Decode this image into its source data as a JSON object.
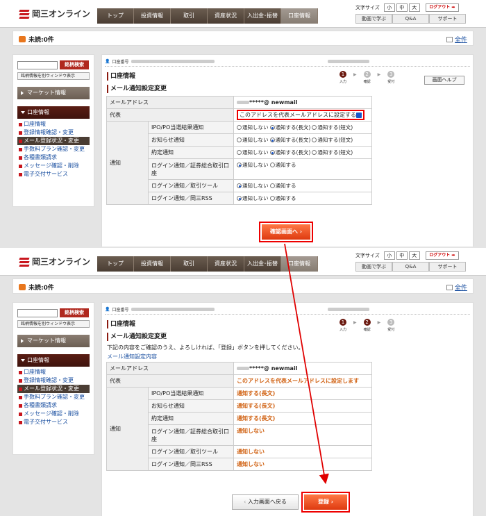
{
  "header": {
    "logo_text": "岡三オンライン",
    "nav": [
      "トップ",
      "投資情報",
      "取引",
      "資産状況",
      "入出金･振替",
      "口座情報"
    ],
    "font_size_label": "文字サイズ",
    "font_sizes": [
      "小",
      "中",
      "大"
    ],
    "logout": "ログアウト",
    "util_links": [
      "動画で学ぶ",
      "Q&A",
      "サポート"
    ]
  },
  "infobar": {
    "unread": "未読:0件",
    "all": "全件"
  },
  "sidebar": {
    "search_button": "銘柄検索",
    "new_window": "銘柄情報を別ウィンドウ表示",
    "market_info": "マーケット情報",
    "account_info": "口座情報",
    "menu": [
      "口座情報",
      "登録情報確認・変更",
      "メール登録状況・変更",
      "手数料プラン確認・変更",
      "各種書類請求",
      "メッセージ確認・削除",
      "電子交付サービス"
    ]
  },
  "main": {
    "account_label": "口座番号",
    "page_title": "口座情報",
    "page_subtitle": "メール通知設定変更",
    "steps": [
      "入力",
      "確認",
      "受付"
    ],
    "help_button": "画面ヘルプ",
    "email_label": "メールアドレス",
    "email_value": "*****@ newmail",
    "primary_label": "代表",
    "primary_checkbox": "このアドレスを代表メールアドレスに設定する",
    "notify_label": "通知",
    "rows": [
      "IPO/PO当選結果通知",
      "お知らせ通知",
      "約定通知",
      "ログイン通知／証券総合取引口座",
      "ログイン通知／取引ツール",
      "ログイン通知／岡三RSS"
    ],
    "opt_none": "通知しない",
    "opt_long": "通知する(長文)",
    "opt_short": "通知する(短文)",
    "opt_on": "通知する",
    "confirm_button": "確認画面へ"
  },
  "confirm": {
    "notice": "下記の内容をご確認のうえ、よろしければ、「登録」ボタンを押してください。",
    "section_link": "メール通知設定内容",
    "primary_value": "このアドレスを代表メールアドレスに設定します",
    "values": [
      "通知する(長文)",
      "通知する(長文)",
      "通知する(長文)",
      "通知しない",
      "通知しない",
      "通知しない"
    ],
    "back_button": "入力画面へ戻る",
    "register_button": "登録"
  },
  "colors": {
    "accent_red": "#e00000",
    "orange_value": "#d06010",
    "brand_red": "#c8161d",
    "nav_brown": "#4a3d33"
  }
}
